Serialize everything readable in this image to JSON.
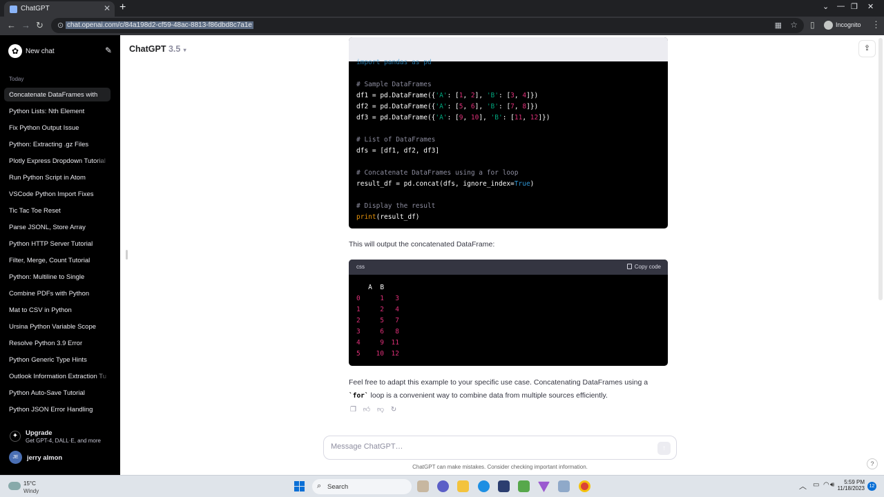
{
  "browser": {
    "tab_title": "ChatGPT",
    "url": "chat.openai.com/c/84a198d2-cf59-48ac-8813-f86dbd8c7a1e",
    "profile_label": "Incognito"
  },
  "sidebar": {
    "new_chat_label": "New chat",
    "section_label": "Today",
    "items": [
      "Concatenate DataFrames with",
      "Python Lists: Nth Element",
      "Fix Python Output Issue",
      "Python: Extracting .gz Files",
      "Plotly Express Dropdown Tutorial",
      "Run Python Script in Atom",
      "VSCode Python Import Fixes",
      "Tic Tac Toe Reset",
      "Parse JSONL, Store Array",
      "Python HTTP Server Tutorial",
      "Filter, Merge, Count Tutorial",
      "Python: Multiline to Single",
      "Combine PDFs with Python",
      "Mat to CSV in Python",
      "Ursina Python Variable Scope",
      "Resolve Python 3.9 Error",
      "Python Generic Type Hints",
      "Outlook Information Extraction Tu",
      "Python Auto-Save Tutorial",
      "Python JSON Error Handling"
    ],
    "upgrade_title": "Upgrade",
    "upgrade_subtitle": "Get GPT-4, DALL·E, and more",
    "user_initials": "JE",
    "user_name": "jerry almon"
  },
  "main": {
    "model_name": "ChatGPT",
    "model_version": "3.5",
    "code1": {
      "line0": "import pandas as pd",
      "line1": "# Sample DataFrames",
      "line5": "# List of DataFrames",
      "line6": "dfs = [df1, df2, df3]",
      "line7": "# Concatenate DataFrames using a for loop",
      "line9": "# Display the result"
    },
    "output_text": "This will output the concatenated DataFrame:",
    "code2": {
      "lang": "css",
      "copy_label": "Copy code",
      "header": "   A  B",
      "rows": [
        [
          "0",
          "1",
          "3"
        ],
        [
          "1",
          "2",
          "4"
        ],
        [
          "2",
          "5",
          "7"
        ],
        [
          "3",
          "6",
          "8"
        ],
        [
          "4",
          "9",
          "11"
        ],
        [
          "5",
          "10",
          "12"
        ]
      ]
    },
    "closing_text_1": "Feel free to adapt this example to your specific use case. Concatenating DataFrames using a",
    "closing_inline_code": "`for`",
    "closing_text_2": " loop is a convenient way to combine data from multiple sources efficiently.",
    "composer_placeholder": "Message ChatGPT…",
    "disclaimer": "ChatGPT can make mistakes. Consider checking important information.",
    "help_label": "?"
  },
  "taskbar": {
    "weather_temp": "15°C",
    "weather_condition": "Windy",
    "search_label": "Search",
    "time": "5:59 PM",
    "date": "11/18/2023",
    "notification_count": "12"
  }
}
